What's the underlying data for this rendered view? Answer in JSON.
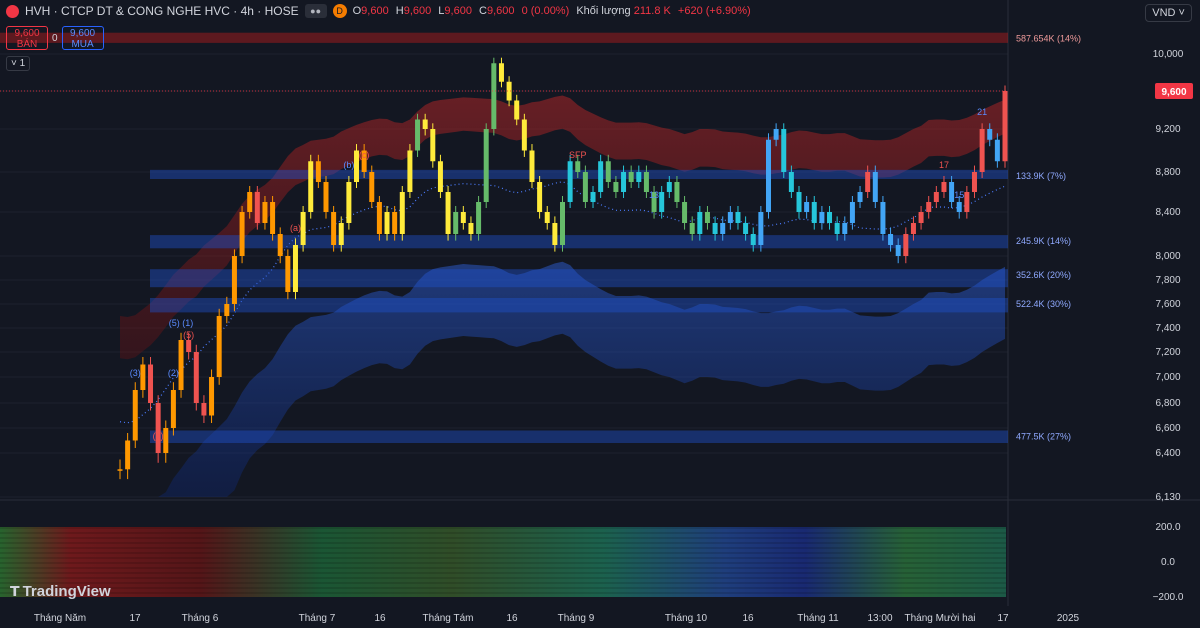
{
  "header": {
    "symbol_title": "HVH · CTCP DT & CONG NGHE HVC · 4h · HOSE",
    "open_label": "O",
    "open": "9,600",
    "high_label": "H",
    "high": "9,600",
    "low_label": "L",
    "low": "9,600",
    "close_label": "C",
    "close": "9,600",
    "change": "0 (0.00%)",
    "volume_label": "Khối lượng",
    "volume": "211.8 K",
    "volume_change": "+620 (+6.90%)",
    "pill_d": "D"
  },
  "trade": {
    "sell_price": "9,600",
    "sell_label": "BÁN",
    "spread": "0",
    "buy_price": "9,600",
    "buy_label": "MUA"
  },
  "indicator_toggle": "˅ 1",
  "currency": "VND ˅",
  "logo_text": "TradingView",
  "colors": {
    "bg": "#131722",
    "up": "#26a69a",
    "down": "#ef5350",
    "red_band": "#b71c1c",
    "blue_band": "#1e4fc7",
    "grid": "#1e222d",
    "price_tag": "#f23645",
    "text": "#d1d4dc"
  },
  "chart_data": [
    {
      "type": "line",
      "title": "HVH 4h",
      "y_ticks": [
        10000,
        9600,
        9200,
        8800,
        8400,
        8000,
        7800,
        7600,
        7400,
        7200,
        7000,
        6800,
        6600,
        6400,
        6130
      ],
      "y_tick_labels": [
        "10,000",
        "9,600",
        "9,200",
        "8,800",
        "8,400",
        "8,000",
        "7,800",
        "7,600",
        "7,400",
        "7,200",
        "7,000",
        "6,800",
        "6,600",
        "6,400",
        "6,130"
      ],
      "ylim": [
        6130,
        10230
      ],
      "last_price_label": "9,600",
      "last_price": 9600,
      "x_labels": [
        "Tháng Năm",
        "17",
        "Tháng 6",
        "Tháng 7",
        "16",
        "Tháng Tám",
        "16",
        "Tháng 9",
        "Tháng 10",
        "16",
        "Tháng 11",
        "13:00",
        "Tháng Mười hai",
        "17",
        "2025"
      ],
      "series": [
        {
          "values": [
            6300,
            6500,
            6900,
            7100,
            6800,
            6400,
            6600,
            6900,
            7300,
            7200,
            6800,
            6700,
            7000,
            7500,
            7600,
            8000,
            8400,
            8600,
            8300,
            8500,
            8200,
            8000,
            7700,
            8100,
            8400,
            8900,
            8700,
            8400,
            8100,
            8300,
            8700,
            9000,
            8800,
            8500,
            8200,
            8400,
            8200,
            8600,
            9000,
            9300,
            9200,
            8900,
            8600,
            8200,
            8400,
            8300,
            8200,
            8500,
            9200,
            9900,
            9700,
            9500,
            9300,
            9000,
            8700,
            8400,
            8300,
            8100,
            8500,
            8900,
            8800,
            8500,
            8600,
            8900,
            8700,
            8600,
            8800,
            8700,
            8800,
            8600,
            8400,
            8600,
            8700,
            8500,
            8300,
            8200,
            8400,
            8300,
            8200,
            8300,
            8400,
            8300,
            8200,
            8100,
            8400,
            9100,
            9200,
            8800,
            8600,
            8400,
            8500,
            8300,
            8400,
            8300,
            8200,
            8300,
            8500,
            8600,
            8800,
            8500,
            8200,
            8100,
            8000,
            8200,
            8300,
            8400,
            8500,
            8600,
            8700,
            8500,
            8400,
            8600,
            8800,
            9200,
            9100,
            8900,
            9600
          ]
        }
      ],
      "zones": [
        {
          "label": "587.654K (14%)",
          "price_from": 10230,
          "price_to": 10120,
          "kind": "supply"
        },
        {
          "label": "133.9K (7%)",
          "price_from": 8820,
          "price_to": 8730,
          "kind": "demand"
        },
        {
          "label": "245.9K (14%)",
          "price_from": 8190,
          "price_to": 8070,
          "kind": "demand"
        },
        {
          "label": "352.6K (20%)",
          "price_from": 7890,
          "price_to": 7740,
          "kind": "demand"
        },
        {
          "label": "522.4K (30%)",
          "price_from": 7650,
          "price_to": 7530,
          "kind": "demand"
        },
        {
          "label": "477.5K (27%)",
          "price_from": 6580,
          "price_to": 6480,
          "kind": "demand"
        }
      ],
      "annotations": [
        "9",
        "(3)",
        "(5)",
        "(5) (1)",
        "(4)",
        "(2)",
        "(a)",
        "(b)",
        "(c)",
        "13",
        "SFP",
        "21",
        "17",
        "15"
      ],
      "grid": true
    },
    {
      "type": "heatmap",
      "title": "",
      "y_ticks": [
        200,
        0,
        -200
      ],
      "y_tick_labels": [
        "200.0",
        "0.0",
        "−200.0"
      ],
      "ylim": [
        -220,
        220
      ]
    }
  ]
}
